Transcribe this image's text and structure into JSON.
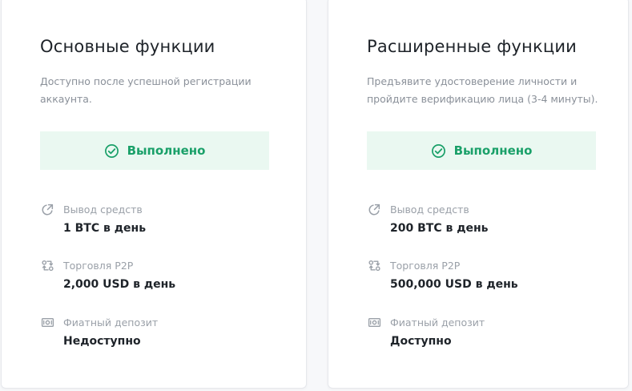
{
  "colors": {
    "success_text": "#1aa069",
    "success_bg": "#eaf8f1",
    "title": "#1e2329",
    "muted": "#8a9099"
  },
  "cards": [
    {
      "title": "Основные функции",
      "description": "Доступно после успешной регистрации аккаунта.",
      "status": {
        "icon": "check-circle-icon",
        "label": "Выполнено"
      },
      "features": [
        {
          "icon": "withdraw-arrow-icon",
          "label": "Вывод средств",
          "value": "1 BTC в день"
        },
        {
          "icon": "p2p-exchange-icon",
          "label": "Торговля P2P",
          "value": "2,000 USD в день"
        },
        {
          "icon": "banknote-icon",
          "label": "Фиатный депозит",
          "value": "Недоступно"
        }
      ]
    },
    {
      "title": "Расширенные функции",
      "description": "Предъявите удостоверение личности и пройдите верификацию лица (3-4 минуты).",
      "status": {
        "icon": "check-circle-icon",
        "label": "Выполнено"
      },
      "features": [
        {
          "icon": "withdraw-arrow-icon",
          "label": "Вывод средств",
          "value": "200 BTC в день"
        },
        {
          "icon": "p2p-exchange-icon",
          "label": "Торговля P2P",
          "value": "500,000 USD в день"
        },
        {
          "icon": "banknote-icon",
          "label": "Фиатный депозит",
          "value": "Доступно"
        }
      ]
    }
  ]
}
